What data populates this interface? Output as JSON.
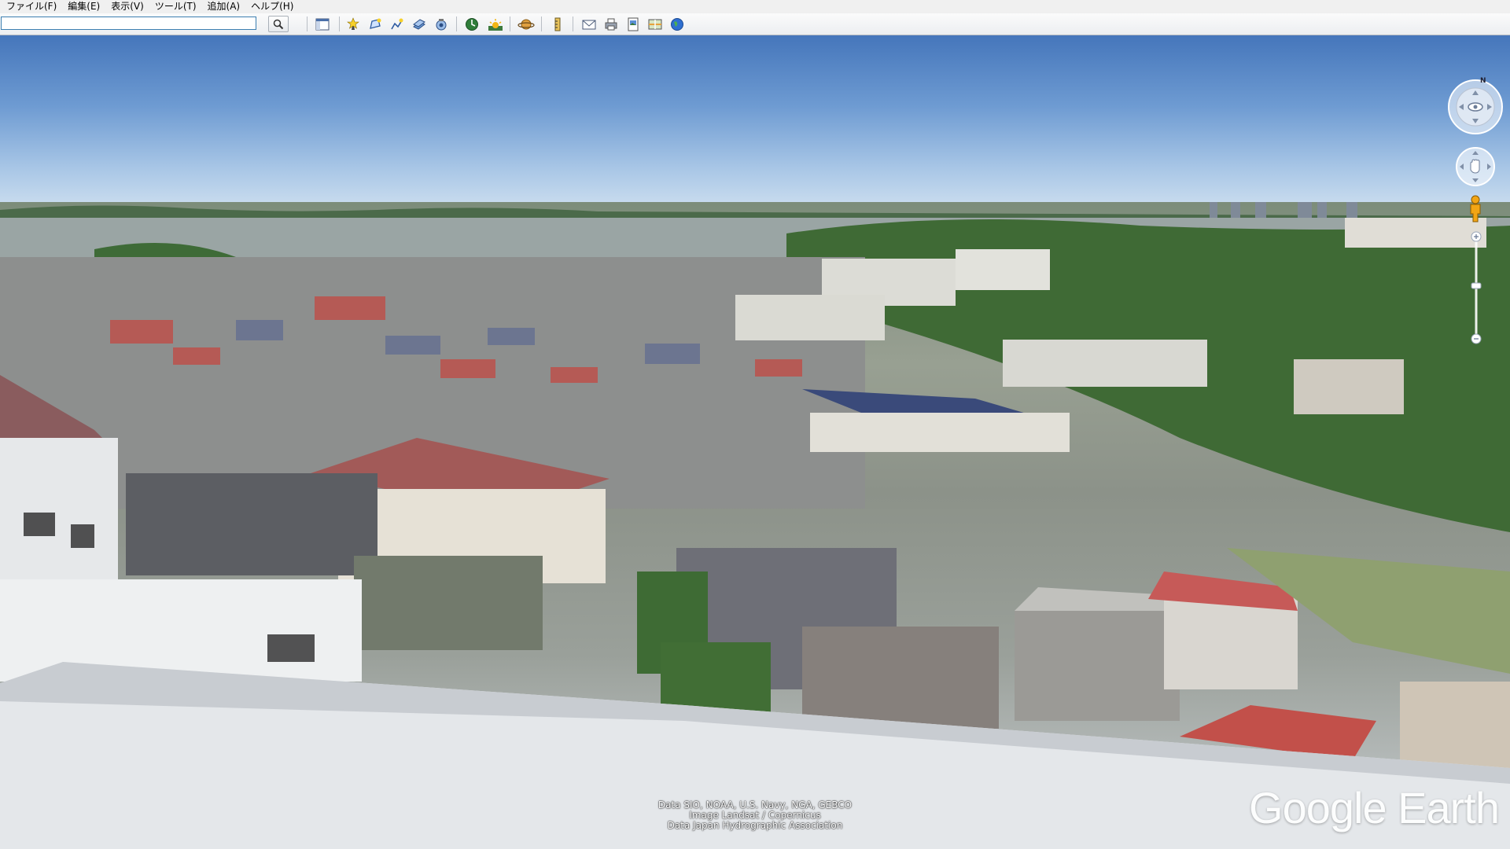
{
  "menu": {
    "items": [
      "ファイル(F)",
      "編集(E)",
      "表示(V)",
      "ツール(T)",
      "追加(A)",
      "ヘルプ(H)"
    ]
  },
  "search": {
    "value": "",
    "placeholder": ""
  },
  "toolbar_icons": [
    "sidebar-icon",
    "placemark-icon",
    "polygon-icon",
    "path-icon",
    "image-overlay-icon",
    "record-tour-icon",
    "historical-imagery-icon",
    "sun-icon",
    "planets-icon",
    "ruler-icon",
    "email-icon",
    "print-icon",
    "save-image-icon",
    "view-in-maps-icon",
    "earth-icon"
  ],
  "attribution": {
    "line1": "Data SIO, NOAA, U.S. Navy, NGA, GEBCO",
    "line2": "Image Landsat / Copernicus",
    "line3": "Data Japan Hydrographic Association"
  },
  "logo_text": "Google Earth",
  "nav": {
    "north_label": "N"
  },
  "colors": {
    "toolbar_bg": "#eef0f3",
    "sky_top": "#4576bb",
    "accent": "#3c7fb1"
  }
}
